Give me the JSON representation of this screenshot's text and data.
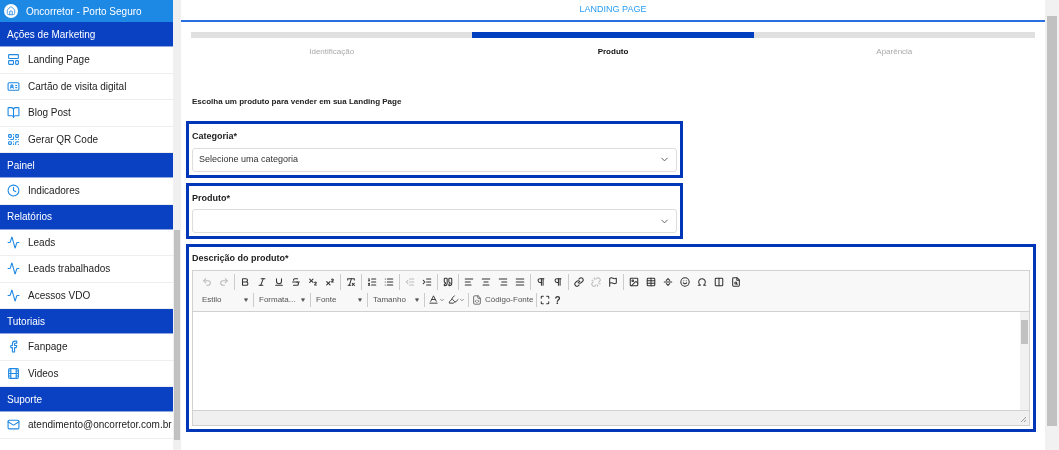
{
  "sidebar": {
    "title": "Oncorretor - Porto Seguro",
    "sections": [
      {
        "title": "Ações de Marketing",
        "items": [
          {
            "label": "Landing Page"
          },
          {
            "label": "Cartão de visita digital"
          },
          {
            "label": "Blog Post"
          },
          {
            "label": "Gerar QR Code"
          }
        ]
      },
      {
        "title": "Painel",
        "items": [
          {
            "label": "Indicadores"
          }
        ]
      },
      {
        "title": "Relatórios",
        "items": [
          {
            "label": "Leads"
          },
          {
            "label": "Leads trabalhados"
          },
          {
            "label": "Acessos VDO"
          }
        ]
      },
      {
        "title": "Tutoriais",
        "items": [
          {
            "label": "Fanpage"
          },
          {
            "label": "Videos"
          }
        ]
      },
      {
        "title": "Suporte",
        "items": [
          {
            "label": "atendimento@oncorretor.com.br"
          }
        ]
      }
    ]
  },
  "header": {
    "title": "LANDING PAGE"
  },
  "steps": [
    {
      "label": "Identificação",
      "selected": false
    },
    {
      "label": "Produto",
      "selected": true
    },
    {
      "label": "Aparência",
      "selected": false
    }
  ],
  "form": {
    "intro": "Escolha um produto para vender em sua Landing Page",
    "category": {
      "label": "Categoria*",
      "value": "Selecione uma categoria"
    },
    "product": {
      "label": "Produto*"
    },
    "description": {
      "label": "Descrição do produto*",
      "toolbar_row1": [
        {
          "buttons": [
            {
              "disabled": true
            },
            {
              "disabled": true
            }
          ]
        },
        {
          "buttons": [
            {
              "disabled": false
            },
            {
              "disabled": false
            },
            {
              "disabled": false
            },
            {
              "disabled": false
            },
            {
              "disabled": false
            },
            {
              "disabled": false
            }
          ]
        },
        {
          "buttons": [
            {
              "disabled": false
            }
          ]
        },
        {
          "buttons": [
            {
              "disabled": false
            },
            {
              "disabled": false
            }
          ]
        },
        {
          "buttons": [
            {
              "disabled": true
            },
            {
              "disabled": false
            }
          ]
        },
        {
          "buttons": [
            {
              "disabled": false
            }
          ]
        },
        {
          "buttons": [
            {
              "disabled": false
            },
            {
              "disabled": false
            },
            {
              "disabled": false
            },
            {
              "disabled": false
            }
          ]
        },
        {
          "buttons": [
            {
              "disabled": false
            },
            {
              "disabled": false
            }
          ]
        },
        {
          "buttons": [
            {
              "disabled": false
            },
            {
              "disabled": true
            },
            {
              "disabled": false
            }
          ]
        },
        {
          "buttons": [
            {
              "disabled": false
            },
            {
              "disabled": false
            },
            {
              "disabled": false
            },
            {
              "disabled": false
            },
            {
              "disabled": false
            },
            {
              "disabled": false
            },
            {
              "disabled": false
            }
          ]
        }
      ],
      "dropdowns": [
        "Estilo",
        "Formata...",
        "Fonte",
        "Tamanho"
      ],
      "source_button": "Código-Fonte",
      "help": "?"
    }
  }
}
